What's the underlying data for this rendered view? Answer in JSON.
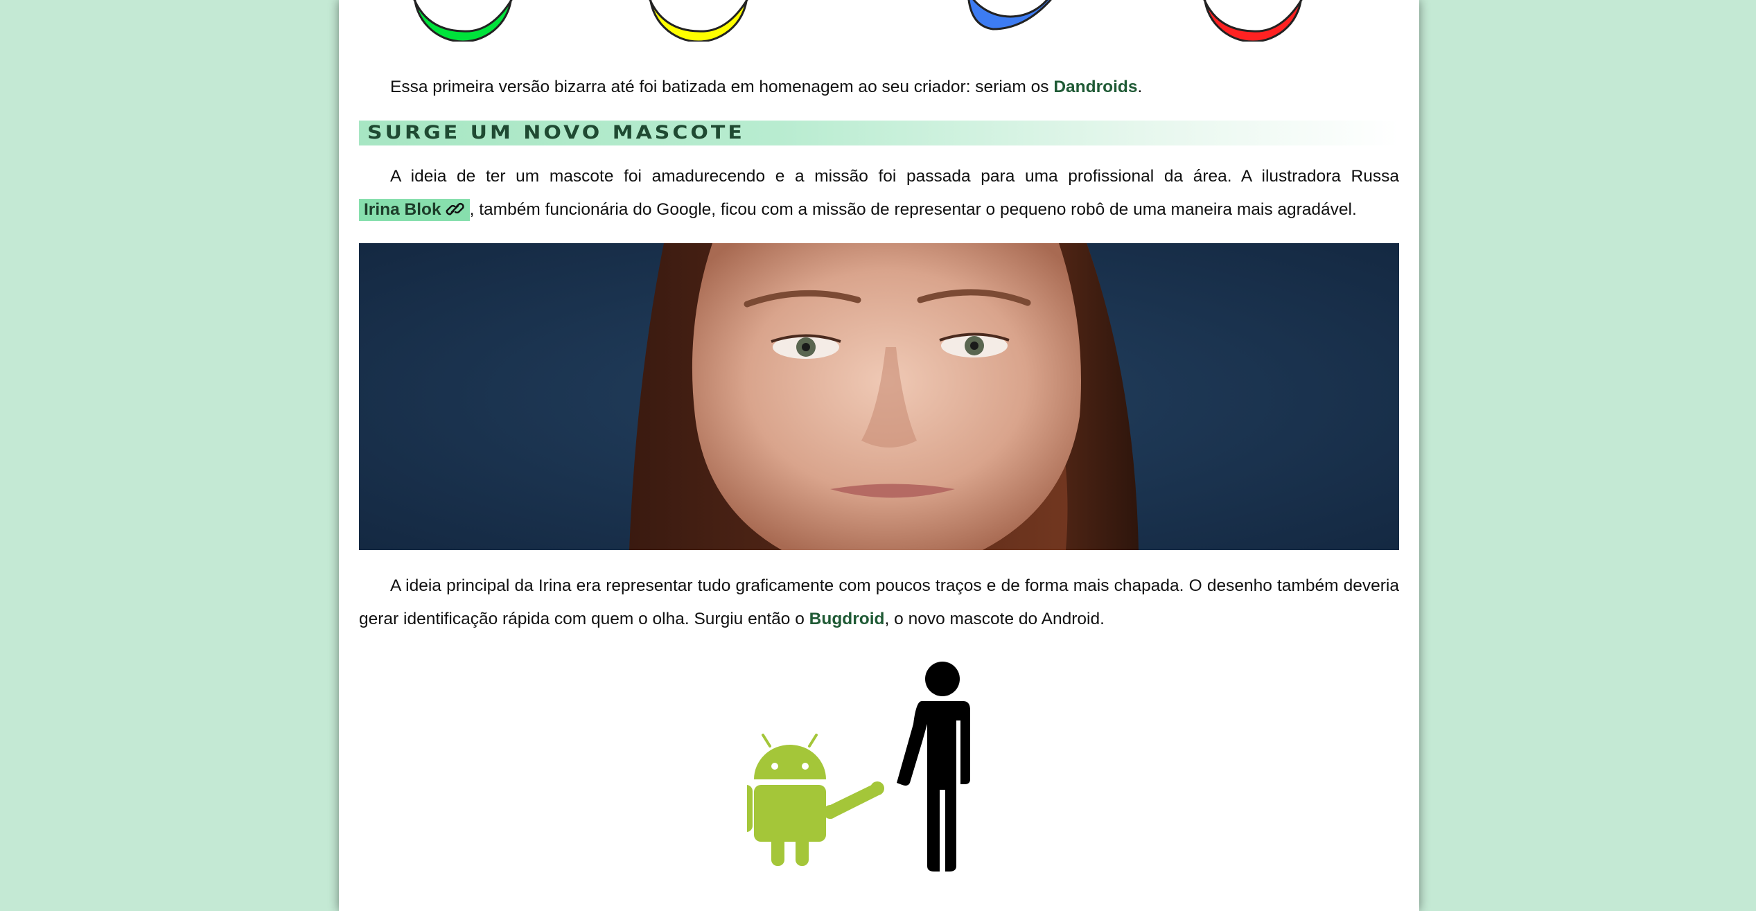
{
  "article": {
    "paragraph1": {
      "before": "Essa primeira versão bizarra até foi batizada em homenagem ao seu criador: seriam os ",
      "highlight": "Dandroids",
      "after": "."
    },
    "section_heading": "Surge um novo mascote",
    "paragraph2": {
      "before": "A ideia de ter um mascote foi amadurecendo e a missão foi passada para uma profissional da área. A ilustradora Russa ",
      "link": "Irina Blok",
      "after": ", também funcionária do Google, ficou com a missão de representar o pequeno robô de uma maneira mais agradável."
    },
    "paragraph3": {
      "before": "A ideia principal da Irina era representar tudo graficamente com poucos traços e de forma mais chapada. O desenho também deveria gerar identificação rápida com quem o olha. Surgiu então o ",
      "highlight": "Bugdroid",
      "after": ", o novo mascote do Android."
    }
  },
  "images": {
    "top_dots_colors": [
      "#00e33b",
      "#ffff00",
      "#3d7cf2",
      "#ff2222"
    ],
    "portrait_bg": "#172d47",
    "android_color": "#a4c639"
  },
  "colors": {
    "page_background": "#c4e9d4",
    "highlight_text": "#1f5a35",
    "link_chip_bg": "#87dfad"
  }
}
